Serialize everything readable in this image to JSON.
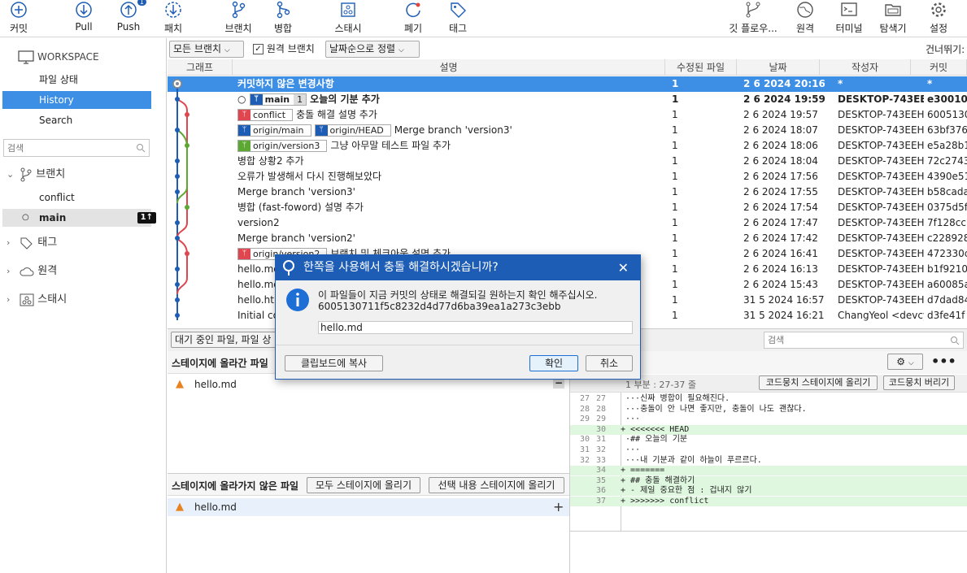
{
  "toolbar": {
    "commit": "커밋",
    "pull": "Pull",
    "push": "Push",
    "push_badge": "1",
    "fetch": "패치",
    "branch": "브랜치",
    "merge": "병합",
    "stash": "스태시",
    "discard": "폐기",
    "tag": "태그",
    "git_flow": "깃 플로우...",
    "remote": "원격",
    "terminal": "터미널",
    "explorer": "탐색기",
    "settings": "설정"
  },
  "sidebar": {
    "workspace": "WORKSPACE",
    "file_status": "파일 상태",
    "history": "History",
    "search": "Search",
    "search_placeholder": "검색",
    "branches": "브랜치",
    "branch_conflict": "conflict",
    "branch_main": "main",
    "main_badge": "1↑",
    "tags": "태그",
    "remotes": "원격",
    "stashes": "스태시"
  },
  "filter": {
    "all_branches": "모든 브랜치",
    "remote_branches": "원격 브랜치",
    "sort": "날짜순으로 정렬",
    "skip": "건너뛰기:"
  },
  "columns": {
    "graph": "그래프",
    "desc": "설명",
    "files": "수정된 파일",
    "date": "날짜",
    "author": "작성자",
    "commit": "커밋"
  },
  "commits": [
    {
      "desc": "커밋하지 않은 변경사항",
      "files": "1",
      "date": "2 6 2024 20:16",
      "author": "*",
      "hash": "*"
    },
    {
      "tag1": "main",
      "tag1b": "1",
      "desc": "오늘의 기분 추가",
      "files": "1",
      "date": "2 6 2024 19:59",
      "author": "DESKTOP-743EEH",
      "hash": "e300108"
    },
    {
      "tag1": "conflict",
      "desc": "충돌 해결 설명 추가",
      "files": "1",
      "date": "2 6 2024 19:57",
      "author": "DESKTOP-743EEH",
      "hash": "6005130"
    },
    {
      "tag1": "origin/main",
      "tag2": "origin/HEAD",
      "desc": "Merge branch 'version3'",
      "files": "1",
      "date": "2 6 2024 18:07",
      "author": "DESKTOP-743EEH",
      "hash": "63bf376"
    },
    {
      "tag1": "origin/version3",
      "desc": "그냥 아무말 테스트 파일 추가",
      "files": "1",
      "date": "2 6 2024 18:06",
      "author": "DESKTOP-743EEH",
      "hash": "e5a28b1"
    },
    {
      "desc": "병합 상황2 추가",
      "files": "1",
      "date": "2 6 2024 18:04",
      "author": "DESKTOP-743EEH",
      "hash": "72c2743"
    },
    {
      "desc": "오류가 발생해서 다시 진행해보았다",
      "files": "1",
      "date": "2 6 2024 17:56",
      "author": "DESKTOP-743EEH",
      "hash": "4390e51"
    },
    {
      "desc": "Merge branch 'version3'",
      "files": "1",
      "date": "2 6 2024 17:55",
      "author": "DESKTOP-743EEH",
      "hash": "b58cada"
    },
    {
      "desc": " 병합 (fast-foword) 설명 추가",
      "files": "1",
      "date": "2 6 2024 17:54",
      "author": "DESKTOP-743EEH",
      "hash": "0375d5f"
    },
    {
      "desc": "version2",
      "files": "1",
      "date": "2 6 2024 17:47",
      "author": "DESKTOP-743EEH",
      "hash": "7f128cc"
    },
    {
      "desc": "Merge branch 'version2'",
      "files": "1",
      "date": "2 6 2024 17:42",
      "author": "DESKTOP-743EEH",
      "hash": "c228928"
    },
    {
      "tag1": "origin/version2",
      "desc": "브랜치 및 체크아웃 설명 추가",
      "files": "1",
      "date": "2 6 2024 16:41",
      "author": "DESKTOP-743EEH",
      "hash": "472330c"
    },
    {
      "desc": "hello.md",
      "files": "1",
      "date": "2 6 2024 16:13",
      "author": "DESKTOP-743EEH",
      "hash": "b1f9210"
    },
    {
      "desc": "hello.md",
      "files": "1",
      "date": "2 6 2024 15:43",
      "author": "DESKTOP-743EEH",
      "hash": "a60085a"
    },
    {
      "desc": "hello.htm",
      "files": "1",
      "date": "31 5 2024 16:57",
      "author": "DESKTOP-743EEH",
      "hash": "d7dad84"
    },
    {
      "desc": "Initial co",
      "files": "1",
      "date": "31 5 2024 16:21",
      "author": "ChangYeol <devcy",
      "hash": "d3fe41f"
    }
  ],
  "lower": {
    "pending_files": "대기 중인 파일, 파일 상",
    "search_placeholder": "검색",
    "staged_title": "스테이지에 올라간 파일",
    "staged_file": "hello.md",
    "unstaged_title": "스테이지에 올라가지 않은 파일",
    "stage_all": "모두 스테이지에 올리기",
    "stage_selected": "선택 내용 스테이지에 올리기",
    "unstaged_file": "hello.md",
    "hunk_label": "1 부분 : 27-37 줄",
    "hunk_stage": "코드뭉치 스테이지에 올리기",
    "hunk_discard": "코드뭉치 버리기"
  },
  "diff": [
    {
      "a": "27",
      "b": "27",
      "t": " ···신짜 병합이 필요해진다.",
      "add": false
    },
    {
      "a": "28",
      "b": "28",
      "t": " ···충돌이 안 나면 좋지만, 충돌이 나도 괜찮다.",
      "add": false
    },
    {
      "a": "29",
      "b": "29",
      "t": " ···",
      "add": false
    },
    {
      "a": "",
      "b": "30",
      "t": "+ <<<<<<< HEAD",
      "add": true
    },
    {
      "a": "30",
      "b": "31",
      "t": " ·## 오늘의 기분",
      "add": false
    },
    {
      "a": "31",
      "b": "32",
      "t": " ···",
      "add": false
    },
    {
      "a": "32",
      "b": "33",
      "t": " ···내 기분과 같이 하늘이 푸르르다.",
      "add": false
    },
    {
      "a": "",
      "b": "34",
      "t": "+ =======",
      "add": true
    },
    {
      "a": "",
      "b": "35",
      "t": "+ ## 충돌 해결하기",
      "add": true
    },
    {
      "a": "",
      "b": "36",
      "t": "+ - 제일 중요한 점 : 겁내지 않기",
      "add": true
    },
    {
      "a": "",
      "b": "37",
      "t": "+ >>>>>>> conflict",
      "add": true
    }
  ],
  "dialog": {
    "title": "한쪽을 사용해서 충돌 해결하시겠습니까?",
    "message": "이 파일들이 지금 커밋의 상태로 해결되길 원하는지 확인 해주십시오.",
    "hash": "6005130711f5c8232d4d77d6ba39ea1a273c3ebb",
    "file": "hello.md",
    "copy": "클립보드에 복사",
    "ok": "확인",
    "cancel": "취소"
  }
}
